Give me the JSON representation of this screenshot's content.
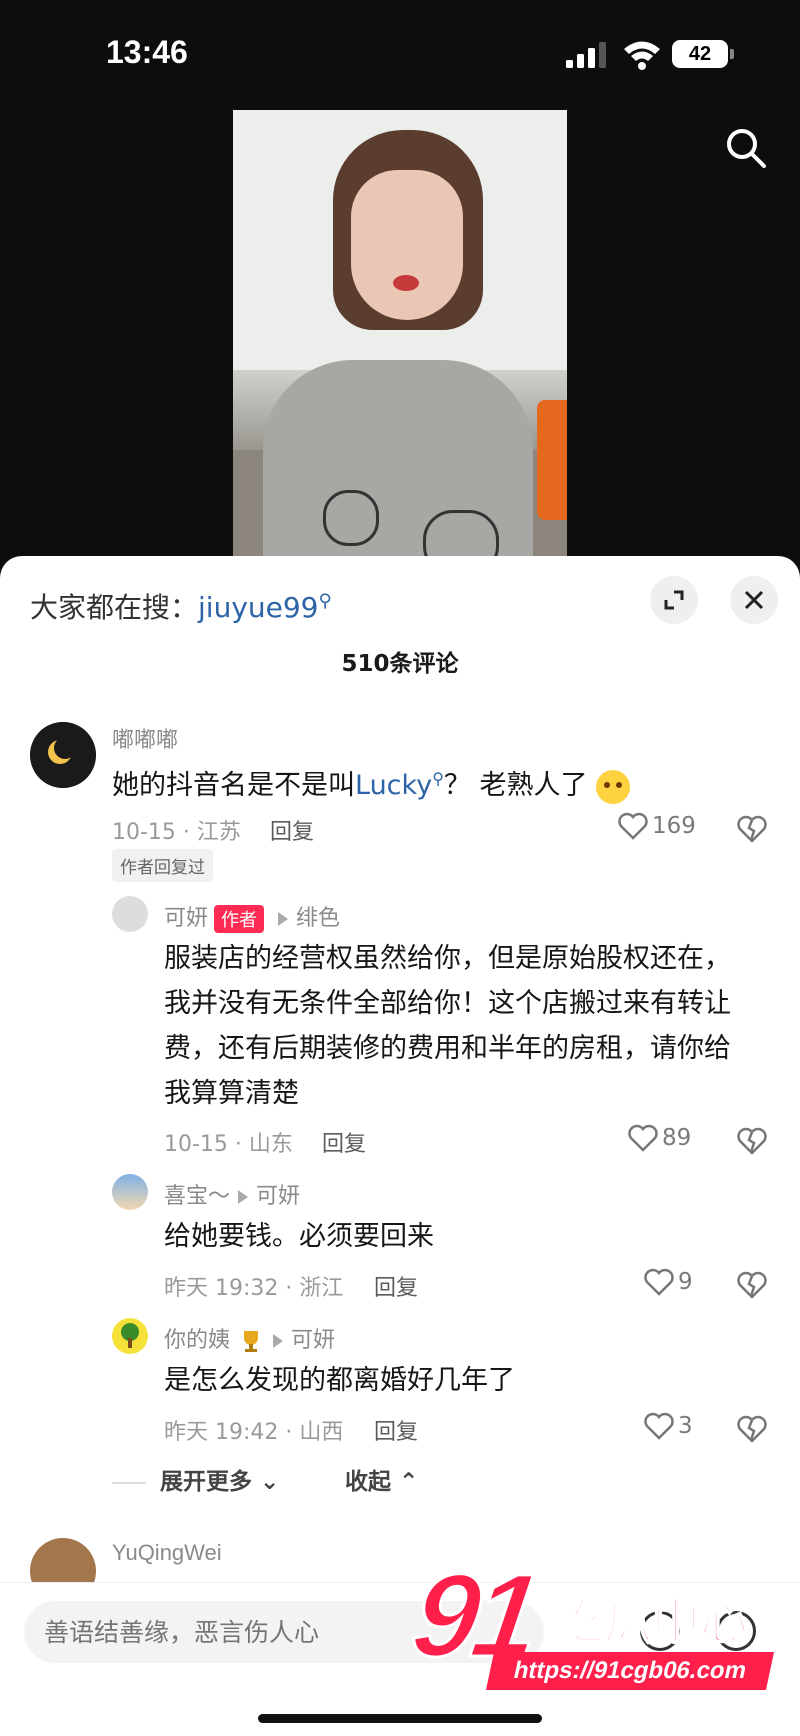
{
  "status_bar": {
    "time": "13:46",
    "battery": "42"
  },
  "header": {
    "search_prefix": "大家都在搜：",
    "search_keyword": "jiuyue99",
    "comment_count": "510条评论"
  },
  "comments": [
    {
      "user": "嘟嘟嘟",
      "text_before": "她的抖音名是不是叫",
      "keyword": "Lucky",
      "text_after": "？ 老熟人了",
      "meta": "10-15 · 江苏",
      "reply_label": "回复",
      "likes": "169",
      "tag": "作者回复过"
    }
  ],
  "replies": [
    {
      "user": "可妍",
      "badge": "作者",
      "to": "绯色",
      "lines": [
        "服装店的经营权虽然给你，但是原始股权还在，",
        "我并没有无条件全部给你！这个店搬过来有转让",
        "费，还有后期装修的费用和半年的房租，请你给",
        "我算算清楚"
      ],
      "meta": "10-15 · 山东",
      "reply_label": "回复",
      "likes": "89"
    },
    {
      "user": "喜宝～",
      "to": "可妍",
      "text": "给她要钱。必须要回来",
      "meta": "昨天 19:32 · 浙江",
      "reply_label": "回复",
      "likes": "9"
    },
    {
      "user": "你的姨",
      "to": "可妍",
      "text": "是怎么发现的都离婚好几年了",
      "meta": "昨天 19:42 · 山西",
      "reply_label": "回复",
      "likes": "3"
    }
  ],
  "expand_more": "展开更多",
  "collapse": "收起",
  "next_user": "YuQingWei",
  "input_placeholder": "善语结善缘，恶言伤人心",
  "watermark": {
    "number": "91",
    "name": "吃瓜中心",
    "url": "https://91cgb06.com"
  },
  "colors": {
    "accent": "#fe2c55",
    "link": "#2d64a8",
    "watermark": "#fe1f4b"
  }
}
